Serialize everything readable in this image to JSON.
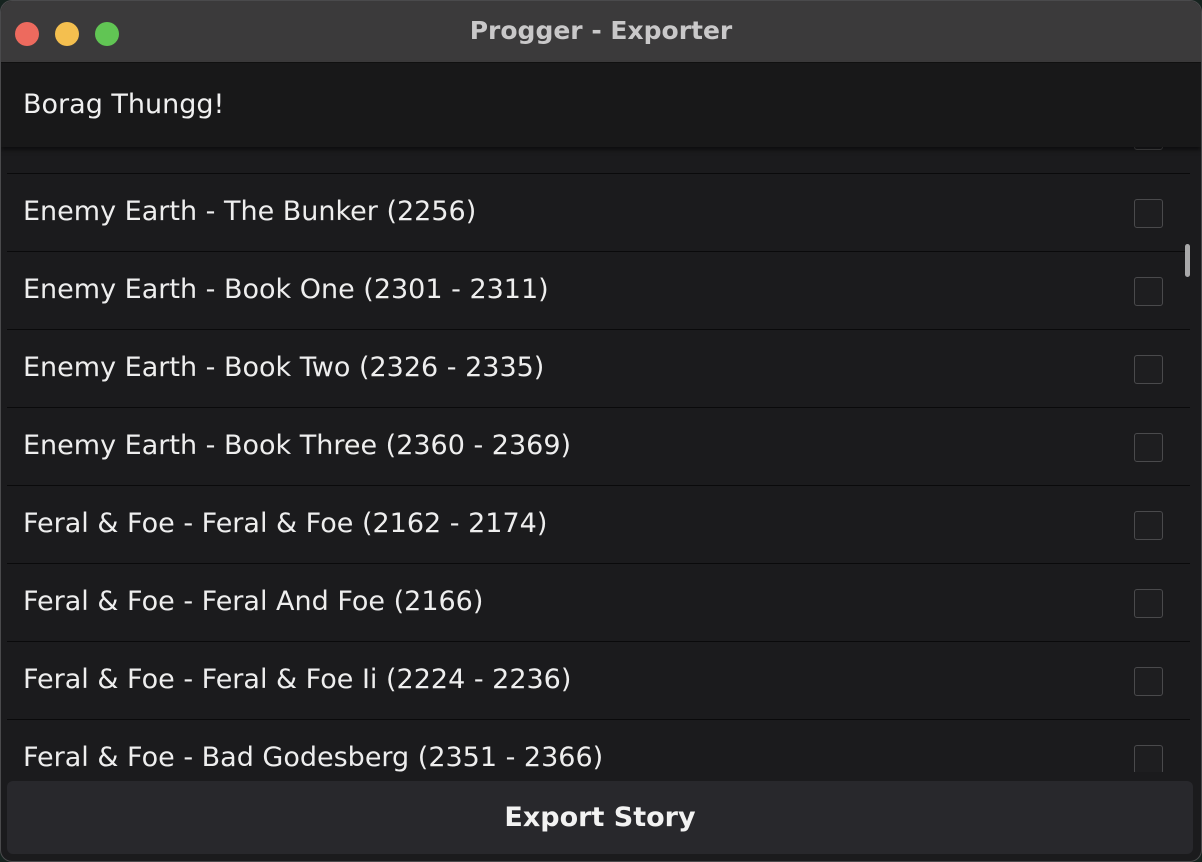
{
  "window": {
    "title": "Progger - Exporter"
  },
  "header": {
    "text": "Borag Thungg!"
  },
  "items": [
    {
      "label": "Enemy Earth - The Bunker (2256)",
      "checked": false
    },
    {
      "label": "Enemy Earth - Book One (2301 - 2311)",
      "checked": false
    },
    {
      "label": "Enemy Earth - Book Two (2326 - 2335)",
      "checked": false
    },
    {
      "label": "Enemy Earth - Book Three (2360 - 2369)",
      "checked": false
    },
    {
      "label": "Feral & Foe - Feral & Foe (2162 - 2174)",
      "checked": false
    },
    {
      "label": "Feral & Foe - Feral And Foe (2166)",
      "checked": false
    },
    {
      "label": "Feral & Foe - Feral & Foe Ii (2224 - 2236)",
      "checked": false
    },
    {
      "label": "Feral & Foe - Bad Godesberg (2351 - 2366)",
      "checked": false
    }
  ],
  "footer": {
    "export_label": "Export Story"
  },
  "colors": {
    "close": "#ed6a5e",
    "minimize": "#f4bf4f",
    "maximize": "#61c554"
  }
}
